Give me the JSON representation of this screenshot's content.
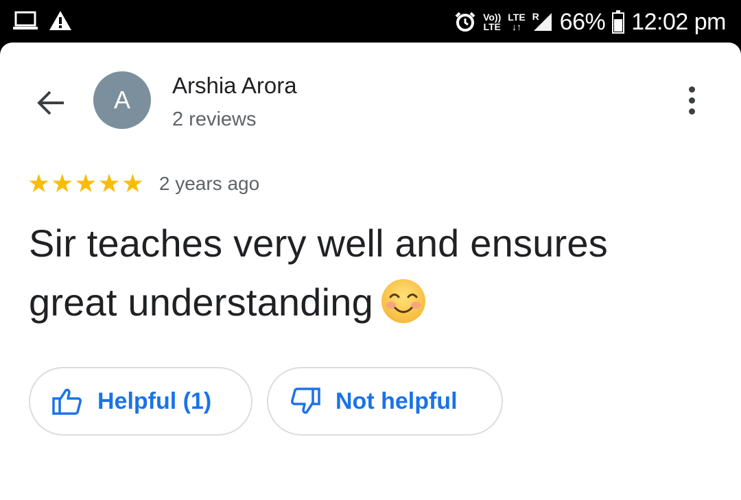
{
  "status_bar": {
    "battery_percent": "66%",
    "time": "12:02 pm",
    "volte_top": "Vo))",
    "volte_bottom": "LTE",
    "lte_label": "LTE",
    "roaming_label": "R",
    "icons": [
      "laptop-icon",
      "warning-icon",
      "alarm-icon",
      "volte-icon",
      "lte-data-icon",
      "signal-icon",
      "battery-icon"
    ]
  },
  "header": {
    "back_icon": "arrow-left-icon",
    "avatar_letter": "A",
    "avatar_color": "#7b909c",
    "reviewer_name": "Arshia Arora",
    "review_count": "2 reviews",
    "more_icon": "more-vertical-icon"
  },
  "review": {
    "rating": 5,
    "max_rating": 5,
    "star_color": "#fbbc04",
    "date": "2 years ago",
    "text_line1": "Sir teaches very well and ensures",
    "text_line2": "great understanding",
    "emoji_icon": "smiling-face-emoji-icon"
  },
  "actions": {
    "accent_color": "#1a73e8",
    "helpful_label": "Helpful (1)",
    "helpful_icon": "thumbs-up-icon",
    "not_helpful_label": "Not helpful",
    "not_helpful_icon": "thumbs-down-icon"
  }
}
